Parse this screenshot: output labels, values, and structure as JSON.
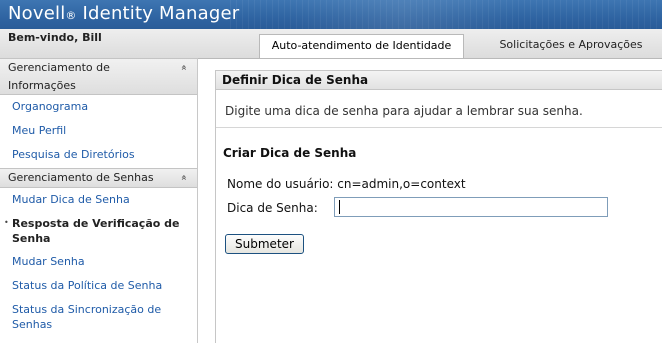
{
  "header": {
    "brand_name": "Novell",
    "brand_reg": "®",
    "product": "Identity Manager"
  },
  "subbar": {
    "welcome": "Bem-vindo, Bill",
    "tabs": [
      {
        "label": "Auto-atendimento de Identidade",
        "active": true
      },
      {
        "label": "Solicitações e Aprovações",
        "active": false
      }
    ]
  },
  "sidebar": {
    "sections": [
      {
        "title_line1": "Gerenciamento de",
        "title_line2": "Informações",
        "items": [
          "Organograma",
          "Meu Perfil",
          "Pesquisa de Diretórios"
        ]
      },
      {
        "title": "Gerenciamento de Senhas",
        "items": [
          "Mudar Dica de Senha",
          "Resposta de Verificação de",
          "Senha",
          "Mudar Senha",
          "Status da Política de Senha",
          "Status da Sincronização de",
          "Senhas"
        ]
      }
    ],
    "collapse_icon": "«",
    "bullet": "•"
  },
  "main": {
    "panel_title": "Definir Dica de Senha",
    "intro": "Digite uma dica de senha para ajudar a lembrar sua senha.",
    "form_title": "Criar Dica de Senha",
    "user_label": "Nome do usuário: cn=admin,o=context",
    "hint_label": "Dica de Senha:",
    "hint_value": "",
    "submit_label": "Submeter"
  },
  "colors": {
    "header_blue": "#2f64a2",
    "link_blue": "#1f5ba8"
  }
}
